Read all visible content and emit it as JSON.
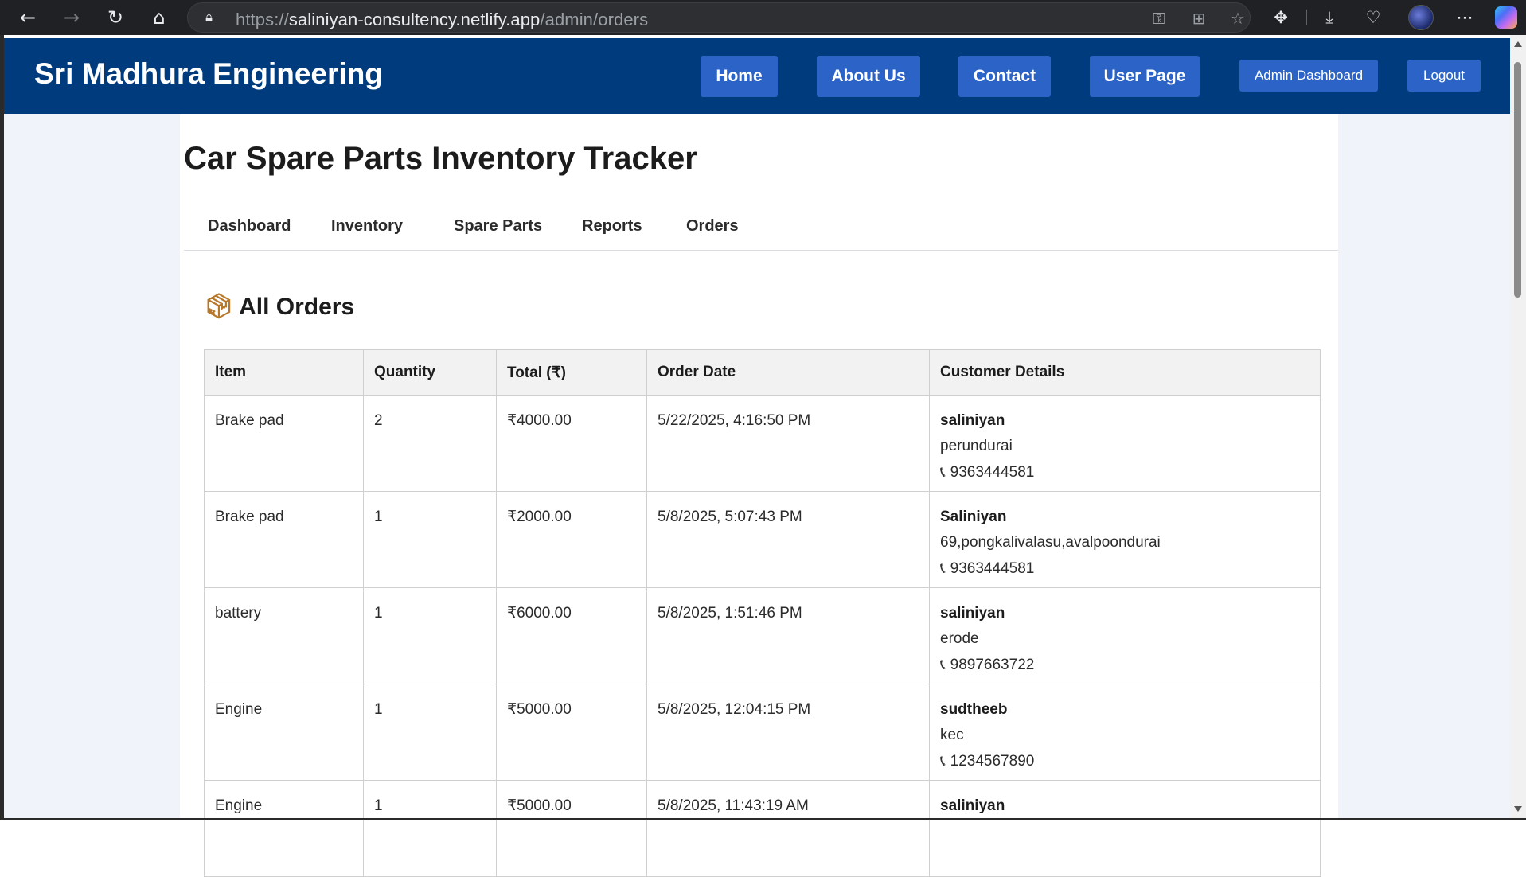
{
  "browser": {
    "url_prefix": "https://",
    "url_host": "saliniyan-consultency.netlify.app",
    "url_path": "/admin/orders",
    "icons": {
      "back": "back-arrow-icon",
      "forward": "forward-arrow-icon",
      "reload": "reload-icon",
      "home": "home-icon",
      "lock": "lock-icon",
      "key": "key-icon",
      "apps": "apps-icon",
      "favorite": "star-icon",
      "extensions": "extensions-icon",
      "downloads": "download-icon",
      "health": "heart-pulse-icon",
      "profile": "avatar",
      "more": "more-icon",
      "copilot": "copilot-icon"
    }
  },
  "header": {
    "brand": "Sri Madhura Engineering",
    "buttons": {
      "home": "Home",
      "about": "About Us",
      "contact": "Contact",
      "user_page": "User Page",
      "admin_dashboard": "Admin Dashboard",
      "logout": "Logout"
    },
    "colors": {
      "background": "#003c7d",
      "button": "#2b63c6"
    }
  },
  "main": {
    "title": "Car Spare Parts Inventory Tracker",
    "tabs": [
      "Dashboard",
      "Inventory",
      "Spare Parts",
      "Reports",
      "Orders"
    ],
    "orders_heading": "All Orders",
    "orders_icon": "package-icon",
    "table": {
      "columns": [
        "Item",
        "Quantity",
        "Total (₹)",
        "Order Date",
        "Customer Details"
      ],
      "rows": [
        {
          "item": "Brake pad",
          "quantity": "2",
          "total": "₹4000.00",
          "date": "5/22/2025, 4:16:50 PM",
          "customer": {
            "name": "saliniyan",
            "address": "perundurai",
            "phone": "9363444581"
          }
        },
        {
          "item": "Brake pad",
          "quantity": "1",
          "total": "₹2000.00",
          "date": "5/8/2025, 5:07:43 PM",
          "customer": {
            "name": "Saliniyan",
            "address": "69,pongkalivalasu,avalpoondurai",
            "phone": "9363444581"
          }
        },
        {
          "item": "battery",
          "quantity": "1",
          "total": "₹6000.00",
          "date": "5/8/2025, 1:51:46 PM",
          "customer": {
            "name": "saliniyan",
            "address": "erode",
            "phone": "9897663722"
          }
        },
        {
          "item": "Engine",
          "quantity": "1",
          "total": "₹5000.00",
          "date": "5/8/2025, 12:04:15 PM",
          "customer": {
            "name": "sudtheeb",
            "address": "kec",
            "phone": "1234567890"
          }
        },
        {
          "item": "Engine",
          "quantity": "1",
          "total": "₹5000.00",
          "date": "5/8/2025, 11:43:19 AM",
          "customer": {
            "name": "saliniyan",
            "address": "",
            "phone": ""
          }
        }
      ]
    }
  }
}
